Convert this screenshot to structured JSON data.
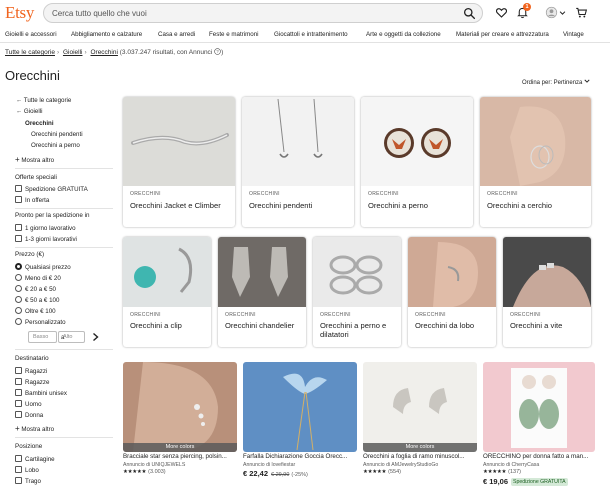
{
  "header": {
    "logo": "Etsy",
    "search_placeholder": "Cerca tutto quello che vuoi",
    "cart_badge": "1",
    "accent": "#F1641E"
  },
  "nav": [
    "Gioielli e accessori",
    "Abbigliamento e calzature",
    "Casa e arredi",
    "Feste e matrimoni",
    "Giocattoli e intrattenimento",
    "Arte e oggetti da collezione",
    "Materiali per creare e attrezzatura",
    "Vintage"
  ],
  "breadcrumb": {
    "items": [
      "Tutte le categorie",
      "Gioielli",
      "Orecchini"
    ],
    "results": "(3.037.247 risultati, con Annunci"
  },
  "page_title": "Orecchini",
  "sort_label": "Ordina per: Pertinenza",
  "sidebar": {
    "categories": {
      "all": "Tutte le categorie",
      "parent": "Gioielli",
      "current": "Orecchini",
      "children": [
        "Orecchini pendenti",
        "Orecchini a perno"
      ],
      "show_more": "Mostra altro"
    },
    "offers": {
      "heading": "Offerte speciali",
      "options": [
        "Spedizione GRATUITA",
        "In offerta"
      ]
    },
    "ready": {
      "heading": "Pronto per la spedizione in",
      "options": [
        "1 giorno lavorativo",
        "1-3 giorni lavorativi"
      ]
    },
    "price": {
      "heading": "Prezzo (€)",
      "options": [
        "Qualsiasi prezzo",
        "Meno di € 20",
        "€ 20 a € 50",
        "€ 50 a € 100",
        "Oltre € 100",
        "Personalizzato"
      ],
      "selected": "Qualsiasi prezzo",
      "min_placeholder": "Basso",
      "to": "a",
      "max_placeholder": "Alto"
    },
    "recipient": {
      "heading": "Destinatario",
      "options": [
        "Ragazzi",
        "Ragazze",
        "Bambini unisex",
        "Uomo",
        "Donna"
      ],
      "show_more": "Mostra altro"
    },
    "position": {
      "heading": "Posizione",
      "options": [
        "Cartilagine",
        "Lobo",
        "Trago"
      ]
    }
  },
  "category_cards": [
    {
      "small": "ORECCHINI",
      "label": "Orecchini Jacket e Climber"
    },
    {
      "small": "ORECCHINI",
      "label": "Orecchini pendenti"
    },
    {
      "small": "ORECCHINI",
      "label": "Orecchini a perno"
    },
    {
      "small": "ORECCHINI",
      "label": "Orecchini a cerchio"
    },
    {
      "small": "ORECCHINI",
      "label": "Orecchini a clip"
    },
    {
      "small": "ORECCHINI",
      "label": "Orecchini chandelier"
    },
    {
      "small": "ORECCHINI",
      "label": "Orecchini a perno e dilatatori"
    },
    {
      "small": "ORECCHINI",
      "label": "Orecchini da lobo"
    },
    {
      "small": "ORECCHINI",
      "label": "Orecchini a vite"
    }
  ],
  "products": [
    {
      "title": "Bracciale star senza piercing, polsin...",
      "shop": "Annuncio di UNIQJEWELS",
      "stars": "★★★★★",
      "count": "(3.003)",
      "more": "More colors"
    },
    {
      "title": "Farfalla Dichiarazione Goccia Orecc...",
      "shop": "Annuncio di lovefiestar",
      "price": "€ 22,42",
      "old_price": "€ 29,90",
      "discount": "(-25%)"
    },
    {
      "title": "Orecchini a foglia di ramo minuscol...",
      "shop": "Annuncio di AMJewelryStudioGo",
      "stars": "★★★★★",
      "count": "(554)",
      "more": "More colors"
    },
    {
      "title": "ORECCHINO per donna fatto a man...",
      "shop": "Annuncio di CherryCasa",
      "stars": "★★★★★",
      "count": "(137)",
      "price": "€ 19,06",
      "free_shipping": "Spedizione GRATUITA"
    }
  ]
}
